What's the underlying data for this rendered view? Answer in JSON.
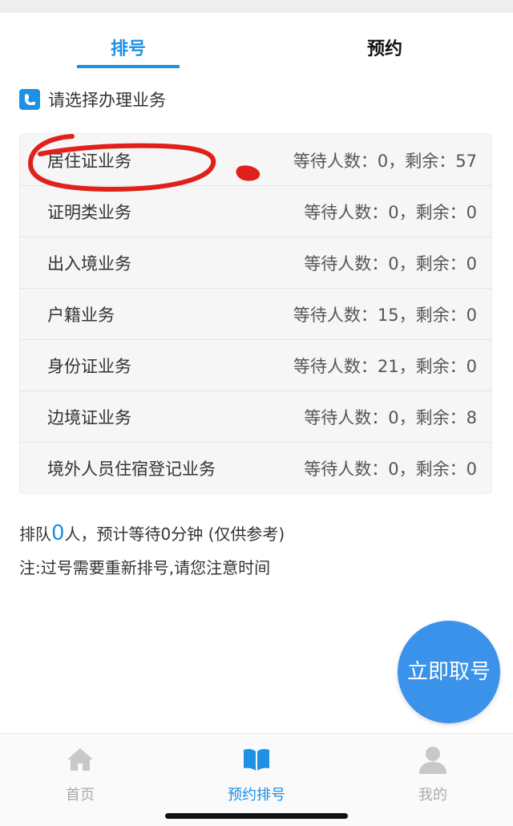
{
  "tabs": {
    "queue_label": "排号",
    "appointment_label": "预约"
  },
  "section": {
    "title": "请选择办理业务"
  },
  "services": [
    {
      "name": "居住证业务",
      "status": "等待人数：0，剩余：57"
    },
    {
      "name": "证明类业务",
      "status": "等待人数：0，剩余：0"
    },
    {
      "name": "出入境业务",
      "status": "等待人数：0，剩余：0"
    },
    {
      "name": "户籍业务",
      "status": "等待人数：15，剩余：0"
    },
    {
      "name": "身份证业务",
      "status": "等待人数：21，剩余：0"
    },
    {
      "name": "边境证业务",
      "status": "等待人数：0，剩余：8"
    },
    {
      "name": "境外人员住宿登记业务",
      "status": "等待人数：0，剩余：0"
    }
  ],
  "queue_info": {
    "prefix": "排队",
    "count": "0",
    "suffix": "人，预计等待0分钟 (仅供参考)"
  },
  "note": "注:过号需要重新排号,请您注意时间",
  "action": {
    "take_number_label": "立即取号"
  },
  "nav": {
    "home_label": "首页",
    "booking_label": "预约排号",
    "me_label": "我的"
  },
  "colors": {
    "accent": "#1e90e6",
    "fab": "#3a92ea",
    "annotation": "#e0211b"
  },
  "icons": {
    "section": "phone-icon",
    "home": "home-icon",
    "booking": "book-icon",
    "me": "user-icon"
  }
}
